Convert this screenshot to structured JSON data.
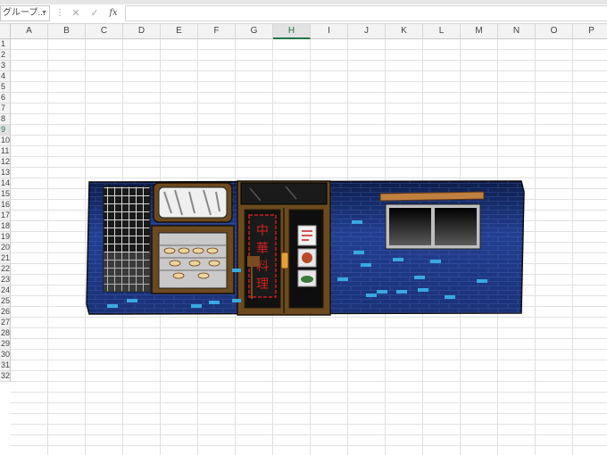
{
  "name_box": {
    "value": "グループ..."
  },
  "formula_bar": {
    "cancel_icon": "✕",
    "enter_icon": "✓",
    "fx_label": "fx",
    "value": ""
  },
  "columns": [
    "A",
    "B",
    "C",
    "D",
    "E",
    "F",
    "G",
    "H",
    "I",
    "J",
    "K",
    "L",
    "M",
    "N",
    "O",
    "P"
  ],
  "selected_column": "H",
  "rows": [
    "1",
    "2",
    "3",
    "4",
    "5",
    "6",
    "7",
    "8",
    "9",
    "10",
    "11",
    "12",
    "13",
    "14",
    "15",
    "16",
    "17",
    "18",
    "19",
    "20",
    "21",
    "22",
    "23",
    "24",
    "25",
    "26",
    "27",
    "28",
    "29",
    "30",
    "31",
    "32"
  ],
  "selected_row": "9",
  "picture": {
    "description_icon": "storefront-illustration",
    "signboard_text": "中華料理",
    "colors": {
      "wall": "#1e3a8a",
      "wall_dark": "#0d1f4f",
      "brick_light": "#39a9e0",
      "wood": "#6b4a1e",
      "window_glass": "#1a1a1a"
    }
  }
}
